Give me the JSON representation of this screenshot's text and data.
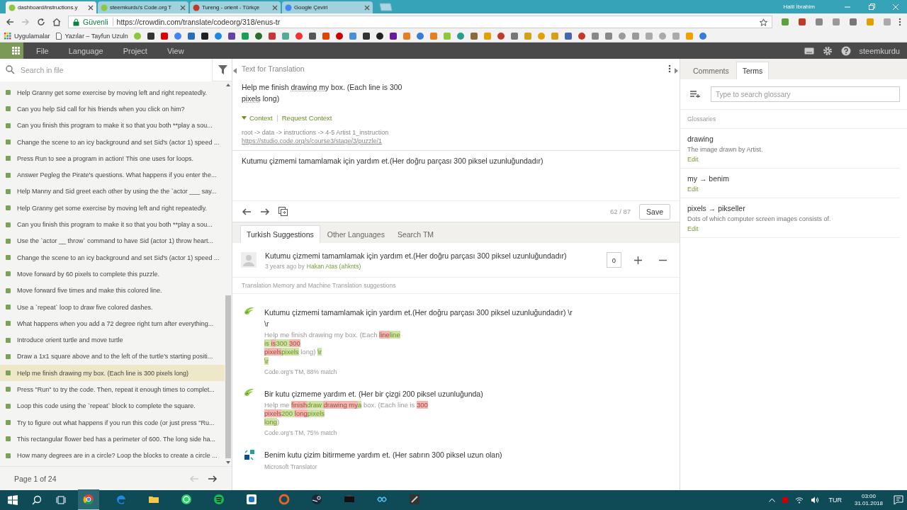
{
  "browser": {
    "tabs": [
      {
        "title": "dashboard/instructions.y",
        "selected": true
      },
      {
        "title": "steemkurdu's Code.org T",
        "selected": false
      },
      {
        "title": "Tureng - orient - Türkçe",
        "selected": false
      },
      {
        "title": "Google Çeviri",
        "selected": false
      }
    ],
    "user": "Halil İbrahim",
    "secure_label": "Güvenli",
    "url": "https://crowdin.com/translate/codeorg/318/enus-tr",
    "bookmarks": [
      {
        "label": "Uygulamalar"
      },
      {
        "label": "Yazılar – Tayfun Uzuln"
      }
    ]
  },
  "app_menu": {
    "items": [
      "File",
      "Language",
      "Project",
      "View"
    ],
    "user": "steemkurdu"
  },
  "strings_panel": {
    "search": {
      "placeholder": "Search in file"
    },
    "items": [
      {
        "text": "Help Granny get some exercise by moving left and right repeatedly.",
        "selected": false
      },
      {
        "text": "Can you help Sid call for his friends when you click on him?",
        "selected": false
      },
      {
        "text": "Can you finish this program to make it so that you both **play a sou...",
        "selected": false
      },
      {
        "text": "Change the scene to an icy background and set Sid's (actor 1) speed ...",
        "selected": false
      },
      {
        "text": "Press Run to see a program in action! This one uses for loops.",
        "selected": false
      },
      {
        "text": "Answer Pegleg the Pirate's questions. What happens if you enter the...",
        "selected": false
      },
      {
        "text": "Help Manny and Sid greet each other by using the the `actor ___ say...",
        "selected": false
      },
      {
        "text": "Help Granny get some exercise by moving left and right repeatedly.",
        "selected": false
      },
      {
        "text": "Can you finish this program to make it so that you both **play a sou...",
        "selected": false
      },
      {
        "text": "Use the `actor __ throw` command to have Sid (actor 1) throw heart...",
        "selected": false
      },
      {
        "text": "Change the scene to an icy background and set Sid's (actor 1) speed ...",
        "selected": false
      },
      {
        "text": "Move forward by 60 pixels to complete this puzzle.",
        "selected": false
      },
      {
        "text": "Move forward five times and make this colored line.",
        "selected": false
      },
      {
        "text": "Use a `repeat` loop to draw five colored dashes.",
        "selected": false
      },
      {
        "text": "What happens when you add a 72 degree right turn after everything...",
        "selected": false
      },
      {
        "text": "Introduce orient turtle and move turtle",
        "selected": false
      },
      {
        "text": "Draw a 1x1 square above and to the left of the turtle's starting positi...",
        "selected": false
      },
      {
        "text": "Help me finish drawing my box. (Each line is 300 pixels long)",
        "selected": true
      },
      {
        "text": "Press \"Run\" to try the code. Then, repeat it enough times to complet...",
        "selected": false
      },
      {
        "text": "Loop this code using the `repeat` block to complete the square.",
        "selected": false
      },
      {
        "text": "Try to figure out what happens if you run this code (or just press \"Ru...",
        "selected": false
      },
      {
        "text": "This rectangular flower bed has a perimeter of 600. The long side ha...",
        "selected": false
      },
      {
        "text": "How many degrees are in a circle? Loop the blocks to create a circle ...",
        "selected": false
      }
    ],
    "page": "Page 1 of 24"
  },
  "editor": {
    "header": "Text for Translation",
    "source_lines": [
      [
        {
          "text": "Help me finish "
        },
        {
          "text": "drawing ",
          "term": true
        },
        {
          "text": "my",
          "term": true
        },
        {
          "text": " box. (Each line is 300"
        }
      ],
      [
        {
          "text": "pixels",
          "term": true
        },
        {
          "text": " long)"
        }
      ]
    ],
    "context_toggle": "Context",
    "request_context": "Request Context",
    "context_path": "root -> data -> instructions -> 4-5 Artist 1_instruction",
    "context_link": "https://studio.code.org/s/course3/stage/3/puzzle/1",
    "translation": "Kutumu çizmemi tamamlamak için yardım et.(Her doğru parçası 300 piksel uzunluğundadır)",
    "counter": "62 / 87",
    "save": "Save"
  },
  "suggestions": {
    "tabs": [
      {
        "label": "Turkish Suggestions",
        "selected": true
      },
      {
        "label": "Other Languages",
        "selected": false
      },
      {
        "label": "Search TM",
        "selected": false
      }
    ],
    "own": {
      "text": "Kutumu çizmemi tamamlamak için yardım et.(Her doğru parçası 300 piksel uzunluğundadır)",
      "time": "3 years ago by",
      "author": "Hakan Atas (ahknts)",
      "votes": "0"
    },
    "tm_header": "Translation Memory and Machine Translation suggestions",
    "tm": [
      {
        "kind": "tm",
        "text_lines": [
          "Kutumu çizmemi tamamlamak için yardım et.(Her doğru parçası 300 piksel uzunluğundadır) \\r",
          "\\r"
        ],
        "diff_lines": [
          [
            {
              "text": "Help me finish drawing my box. (Each ",
              "kind": "plain"
            },
            {
              "text": "line",
              "kind": "del"
            },
            {
              "text": "line",
              "kind": "ins"
            }
          ],
          [
            {
              "text": "is ",
              "kind": "ins"
            },
            {
              "text": "is",
              "kind": "del"
            },
            {
              "text": "300 ",
              "kind": "ins"
            },
            {
              "text": "300",
              "kind": "del"
            }
          ],
          [
            {
              "text": "pixels",
              "kind": "del"
            },
            {
              "text": "pixels",
              "kind": "ins"
            },
            {
              "text": " long) ",
              "kind": "plain"
            },
            {
              "text": "\\r",
              "kind": "ins"
            }
          ],
          [
            {
              "text": "\\r",
              "kind": "ins"
            }
          ]
        ],
        "source": "Code.org's TM, 88% match"
      },
      {
        "kind": "tm",
        "text_lines": [
          "Bir kutu çizmeme yardım et. (Her bir çizgi 200 piksel uzunluğunda)"
        ],
        "diff_lines": [
          [
            {
              "text": "Help me ",
              "kind": "plain"
            },
            {
              "text": "finish",
              "kind": "del"
            },
            {
              "text": "draw ",
              "kind": "ins"
            },
            {
              "text": "drawing ",
              "kind": "del"
            },
            {
              "text": "my",
              "kind": "del"
            },
            {
              "text": "a",
              "kind": "ins"
            },
            {
              "text": " box. (Each line is ",
              "kind": "plain"
            },
            {
              "text": "300",
              "kind": "del"
            }
          ],
          [
            {
              "text": "pixels",
              "kind": "del"
            },
            {
              "text": "200 ",
              "kind": "ins"
            },
            {
              "text": "long",
              "kind": "del"
            },
            {
              "text": "pixels",
              "kind": "ins"
            }
          ],
          [
            {
              "text": "long",
              "kind": "ins"
            },
            {
              "text": ")",
              "kind": "plain"
            }
          ]
        ],
        "source": "Code.org's TM, 75% match"
      },
      {
        "kind": "mt",
        "text_lines": [
          "Benim kutu çizim bitirmeme yardım et. (Her satırın 300 piksel uzun olan)"
        ],
        "source": "Microsoft Translator"
      }
    ]
  },
  "side_panel": {
    "tabs": [
      {
        "label": "Comments",
        "selected": false
      },
      {
        "label": "Terms",
        "selected": true
      }
    ],
    "search": {
      "placeholder": "Type to search glossary"
    },
    "section": "Glossaries",
    "terms": [
      {
        "term": "drawing",
        "description": "The image drawn by Artist.",
        "edit": "Edit"
      },
      {
        "term": "my → benim",
        "edit": "Edit"
      },
      {
        "term": "pixels → pikseller",
        "description": "Dots of which computer screen images consists of.",
        "edit": "Edit"
      }
    ]
  },
  "taskbar": {
    "language": "TUR",
    "time": "03:00",
    "date": "31.01.2018"
  }
}
